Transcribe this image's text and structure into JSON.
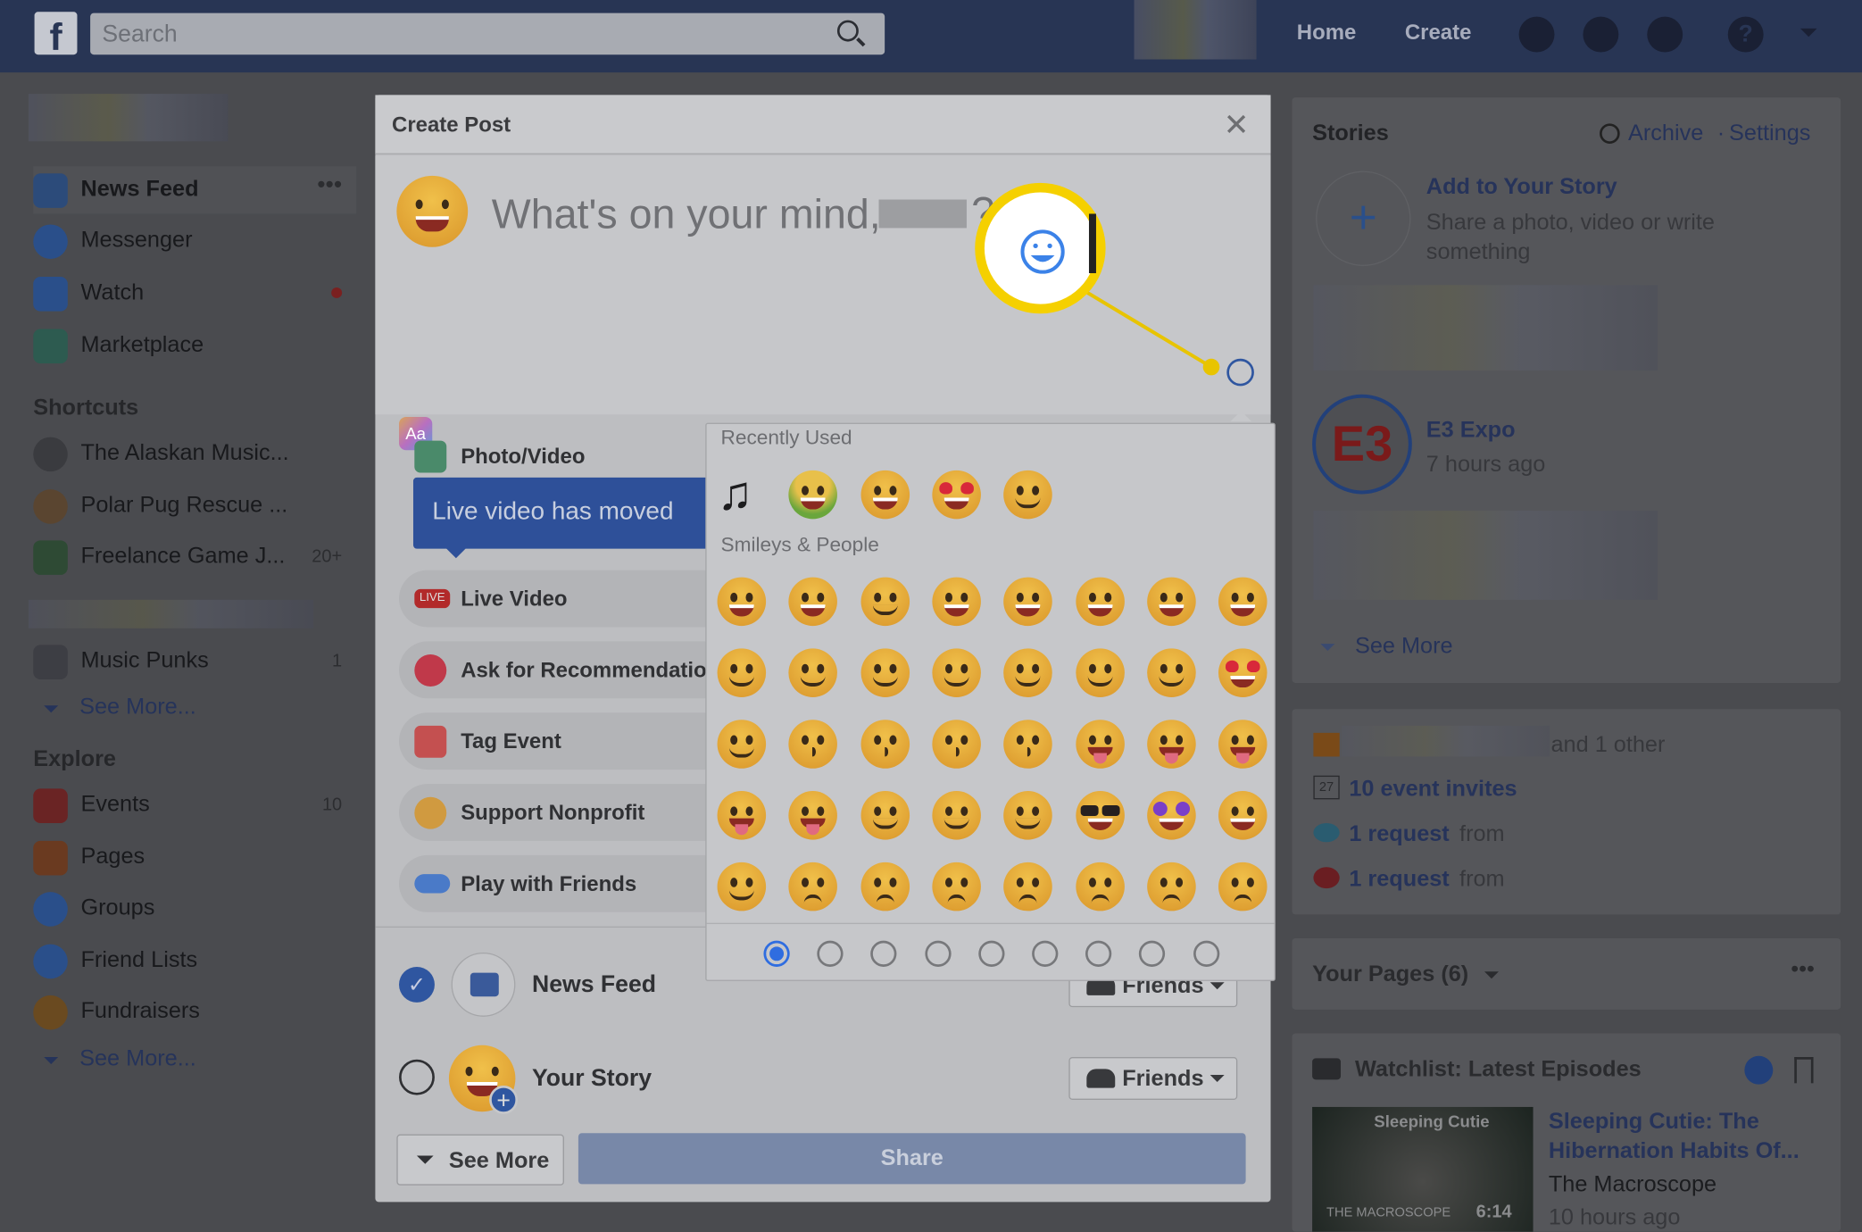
{
  "topbar": {
    "search_placeholder": "Search",
    "home": "Home",
    "create": "Create"
  },
  "sidebar": {
    "main": [
      {
        "label": "News Feed",
        "icon": "news-feed-icon"
      },
      {
        "label": "Messenger",
        "icon": "messenger-icon"
      },
      {
        "label": "Watch",
        "icon": "watch-icon"
      },
      {
        "label": "Marketplace",
        "icon": "marketplace-icon"
      }
    ],
    "shortcuts_title": "Shortcuts",
    "shortcuts": [
      {
        "label": "The Alaskan Music...",
        "count": ""
      },
      {
        "label": "Polar Pug Rescue ...",
        "count": ""
      },
      {
        "label": "Freelance Game J...",
        "count": "20+"
      },
      {
        "label": "Music Punks",
        "count": "1"
      }
    ],
    "see_more": "See More...",
    "explore_title": "Explore",
    "explore": [
      {
        "label": "Events",
        "count": "10"
      },
      {
        "label": "Pages",
        "count": ""
      },
      {
        "label": "Groups",
        "count": ""
      },
      {
        "label": "Friend Lists",
        "count": ""
      },
      {
        "label": "Fundraisers",
        "count": ""
      }
    ]
  },
  "modal": {
    "title": "Create Post",
    "placeholder": "What's on your mind,",
    "options": [
      "Photo/Video",
      "Live Video",
      "Ask for Recommendations",
      "Tag Event",
      "Support Nonprofit",
      "Play with Friends"
    ],
    "tooltip": "Live video has moved",
    "destinations": [
      {
        "label": "News Feed",
        "checked": true,
        "audience": "Friends"
      },
      {
        "label": "Your Story",
        "checked": false,
        "audience": "Friends"
      }
    ],
    "see_more": "See More",
    "share": "Share"
  },
  "emoji_panel": {
    "recent_title": "Recently Used",
    "recent": [
      "musical-notes",
      "nauseated-face",
      "rolling-on-floor-laughing",
      "heart-eyes",
      "thinking-face"
    ],
    "smileys_title": "Smileys & People",
    "smileys": [
      [
        "grinning",
        "grinning-big-eyes",
        "grinning-smiling-eyes",
        "beaming",
        "grinning-squinting",
        "grinning-sweat",
        "tears-of-joy",
        "rolling-on-floor-laughing"
      ],
      [
        "smiling-eyes",
        "blush",
        "halo",
        "slightly-smiling",
        "upside-down",
        "winking",
        "relieved",
        "heart-eyes"
      ],
      [
        "smiling-hearts",
        "kissing-heart",
        "kissing",
        "kissing-smiling-eyes",
        "kissing-closed-eyes",
        "yum",
        "tongue",
        "squinting-tongue"
      ],
      [
        "winking-tongue",
        "zany",
        "raised-eyebrow",
        "monocle",
        "nerd",
        "sunglasses",
        "star-struck",
        "partying"
      ],
      [
        "smirking",
        "unamused",
        "disappointed",
        "pensive",
        "worried",
        "confused",
        "slightly-frowning",
        "frowning"
      ]
    ],
    "tabs": [
      "recent-icon",
      "smileys-icon",
      "animals-icon",
      "food-icon",
      "activity-icon",
      "travel-icon",
      "objects-icon",
      "symbols-icon",
      "flags-icon"
    ],
    "active_tab": "recent-icon"
  },
  "right": {
    "stories_title": "Stories",
    "archive": "Archive",
    "settings": "Settings",
    "sep": "·",
    "add_story": "Add to Your Story",
    "add_story_sub": "Share a photo, video or write something",
    "e3_name": "E3 Expo",
    "e3_time": "7 hours ago",
    "e3_logo": "E3",
    "see_more": "See More",
    "birthday": "and 1 other",
    "event_invites": "10 event invites",
    "request_1": "1 request",
    "from": "from",
    "request_2": "1 request",
    "calendar_day": "27",
    "your_pages": "Your Pages (6)",
    "watchlist": "Watchlist: Latest Episodes",
    "video_thumb_title": "Sleeping Cutie",
    "video_thumb_brand": "THE MACROSCOPE",
    "video_duration": "6:14",
    "video_title": "Sleeping Cutie: The Hibernation Habits Of...",
    "video_channel": "The Macroscope",
    "video_time": "10 hours ago"
  },
  "colors": {
    "topbar": "#283554",
    "highlight": "#f5d000",
    "accent": "#2f6de0"
  }
}
